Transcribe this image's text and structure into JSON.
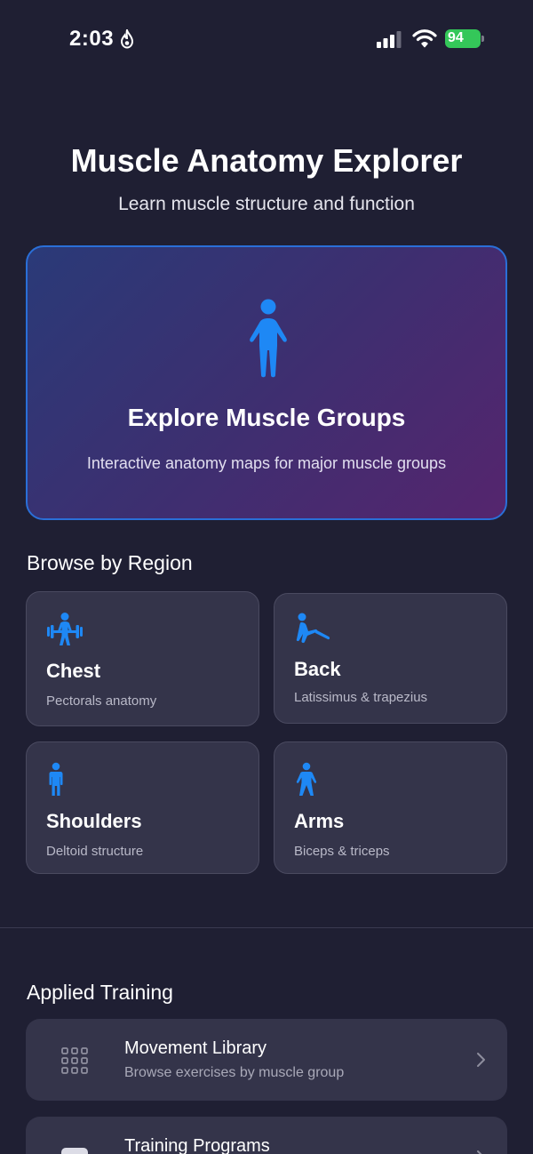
{
  "status": {
    "time": "2:03",
    "battery": "94"
  },
  "header": {
    "title": "Muscle Anatomy Explorer",
    "subtitle": "Learn muscle structure and function"
  },
  "hero": {
    "title": "Explore Muscle Groups",
    "description": "Interactive anatomy maps for major muscle groups",
    "icon": "figure-standing-icon"
  },
  "browse": {
    "heading": "Browse by Region",
    "regions": [
      {
        "name": "Chest",
        "description": "Pectorals anatomy",
        "icon": "figure-strengthtraining-icon"
      },
      {
        "name": "Back",
        "description": "Latissimus & trapezius",
        "icon": "figure-stretching-icon"
      },
      {
        "name": "Shoulders",
        "description": "Deltoid structure",
        "icon": "figure-stand-icon"
      },
      {
        "name": "Arms",
        "description": "Biceps & triceps",
        "icon": "figure-arms-open-icon"
      }
    ]
  },
  "training": {
    "heading": "Applied Training",
    "items": [
      {
        "title": "Movement Library",
        "subtitle": "Browse exercises by muscle group",
        "icon": "grid-icon"
      },
      {
        "title": "Training Programs",
        "subtitle": "",
        "icon": "calendar-icon"
      }
    ]
  },
  "colors": {
    "background": "#1f1f33",
    "accent": "#1e88f5",
    "card": "#34344a",
    "battery": "#34c759"
  }
}
